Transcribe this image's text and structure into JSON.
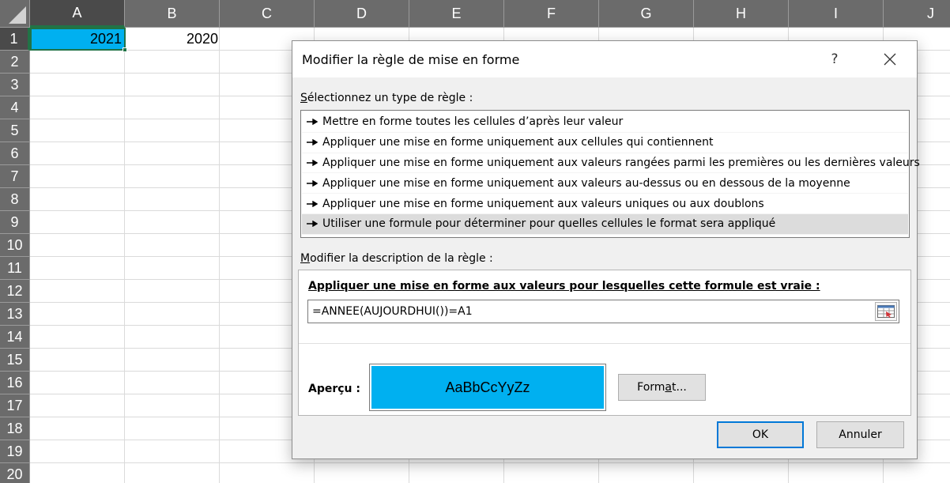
{
  "sheet": {
    "columns": [
      "A",
      "B",
      "C",
      "D",
      "E",
      "F",
      "G",
      "H",
      "I",
      "J"
    ],
    "rows": [
      "1",
      "2",
      "3",
      "4",
      "5",
      "6",
      "7",
      "8",
      "9",
      "10",
      "11",
      "12",
      "13",
      "14",
      "15",
      "16",
      "17",
      "18",
      "19",
      "20"
    ],
    "cells": {
      "A1": "2021",
      "B1": "2020"
    },
    "highlight_color": "#00b0f0"
  },
  "dialog": {
    "title": "Modifier la règle de mise en forme",
    "help": "?",
    "select_rule_type_first": "S",
    "select_rule_type_rest": "électionnez un type de règle :",
    "rule_types": [
      "Mettre en forme toutes les cellules d’après leur valeur",
      "Appliquer une mise en forme uniquement aux cellules qui contiennent",
      "Appliquer une mise en forme uniquement aux valeurs rangées parmi les premières ou les dernières valeurs",
      "Appliquer une mise en forme uniquement aux valeurs au-dessus ou en dessous de la moyenne",
      "Appliquer une mise en forme uniquement aux valeurs uniques ou aux doublons",
      "Utiliser une formule pour déterminer pour quelles cellules le format sera appliqué"
    ],
    "selected_rule_index": 5,
    "edit_desc_first": "M",
    "edit_desc_rest": "odifier la description de la règle :",
    "formula_heading_first": "A",
    "formula_heading_rest": "ppliquer une mise en forme aux valeurs pour lesquelles cette formule est vraie :",
    "formula_value": "=ANNEE(AUJOURDHUI())=A1",
    "preview_label": "Aperçu :",
    "preview_text": "AaBbCcYyZz",
    "format_btn_first": "Form",
    "format_btn_accel": "a",
    "format_btn_rest": "t...",
    "ok": "OK",
    "cancel": "Annuler"
  }
}
